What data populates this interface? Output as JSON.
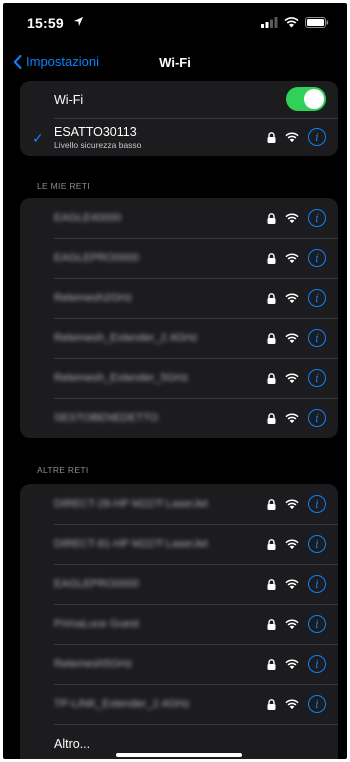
{
  "status_bar": {
    "time": "15:59"
  },
  "nav": {
    "back_label": "Impostazioni",
    "title": "Wi-Fi"
  },
  "wifi_toggle": {
    "label": "Wi-Fi",
    "on": true
  },
  "connected": {
    "ssid": "ESATTO30113",
    "security_note": "Livello sicurezza basso"
  },
  "my_networks": {
    "header": "LE MIE RETI",
    "items": [
      {
        "ssid": "EAGLE40000"
      },
      {
        "ssid": "EAGLEPRO0000"
      },
      {
        "ssid": "Retemesh2GHz"
      },
      {
        "ssid": "Retemesh_Extender_2.4GHz"
      },
      {
        "ssid": "Retemesh_Extender_5GHz"
      },
      {
        "ssid": "SESTOBENEDETTO"
      }
    ]
  },
  "other_networks": {
    "header": "ALTRE RETI",
    "items": [
      {
        "ssid": "DIRECT-28-HP M227f LaserJet"
      },
      {
        "ssid": "DIRECT-81-HP M227f LaserJet"
      },
      {
        "ssid": "EAGLEPRO0000"
      },
      {
        "ssid": "PrimaLuce Guest"
      },
      {
        "ssid": "Retemesh5GHz"
      },
      {
        "ssid": "TP-LINK_Extender_2.4GHz"
      }
    ],
    "other_label": "Altro..."
  },
  "colors": {
    "accent": "#0a84ff",
    "toggle_on": "#30d158",
    "cell_bg": "#1c1c1e",
    "bg": "#000000"
  }
}
